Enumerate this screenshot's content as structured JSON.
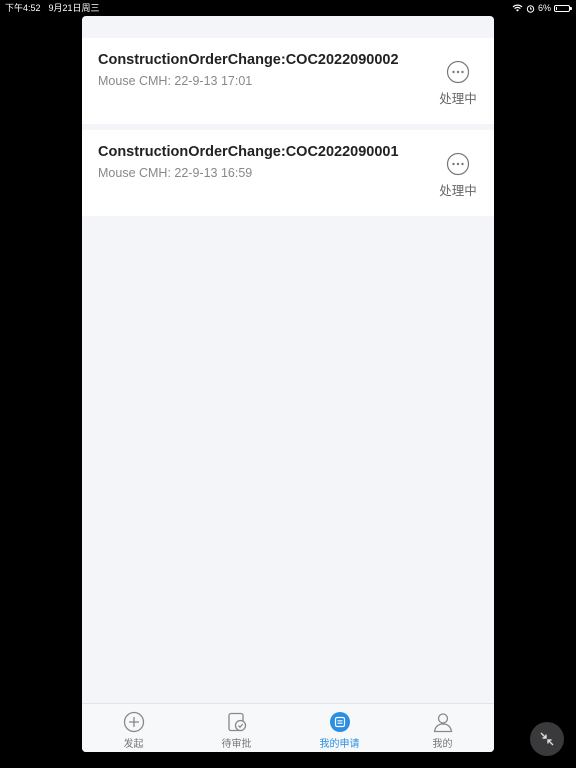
{
  "statusbar": {
    "time": "下午4:52",
    "date": "9月21日周三",
    "battery_text": "6%",
    "battery_level": 0.06
  },
  "list": {
    "items": [
      {
        "title": "ConstructionOrderChange:COC2022090002",
        "subtitle": "Mouse CMH: 22-9-13 17:01",
        "status": "处理中"
      },
      {
        "title": "ConstructionOrderChange:COC2022090001",
        "subtitle": "Mouse CMH: 22-9-13 16:59",
        "status": "处理中"
      }
    ]
  },
  "tabbar": {
    "tabs": [
      {
        "label": "发起",
        "icon": "plus-circle-icon"
      },
      {
        "label": "待审批",
        "icon": "pending-check-icon"
      },
      {
        "label": "我的申请",
        "icon": "my-requests-icon",
        "active": true
      },
      {
        "label": "我的",
        "icon": "user-icon"
      }
    ],
    "active_color": "#2a8fe0"
  },
  "float_button": {
    "icon": "collapse-arrows-icon"
  }
}
